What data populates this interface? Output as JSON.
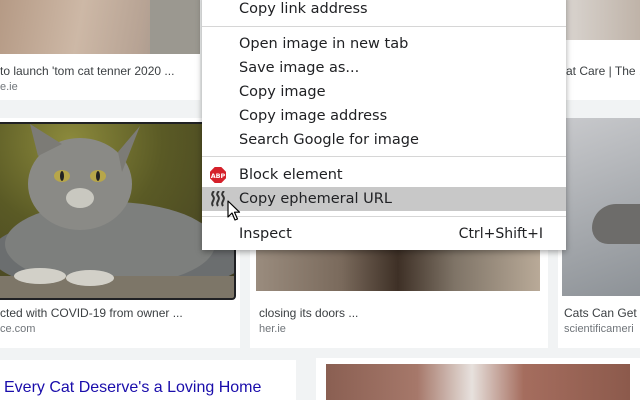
{
  "results": [
    {
      "caption": "to launch 'tom cat tenner 2020 ...",
      "source": "e.ie"
    },
    {
      "caption": "at Care | The ...",
      "source": ""
    },
    {
      "caption": "cted with COVID-19 from owner ...",
      "source": "ce.com"
    },
    {
      "caption": "closing its doors ...",
      "source": "her.ie"
    },
    {
      "caption": "Cats Can Get ...",
      "source": "scientificameri"
    }
  ],
  "bottom_title": "Every Cat Deserve's a Loving Home",
  "context_menu": {
    "items": [
      {
        "label": "Copy link address"
      },
      {
        "label": "Open image in new tab"
      },
      {
        "label": "Save image as..."
      },
      {
        "label": "Copy image"
      },
      {
        "label": "Copy image address"
      },
      {
        "label": "Search Google for image"
      },
      {
        "label": "Block element",
        "icon": "adblock-plus-icon",
        "icon_text": "ABP"
      },
      {
        "label": "Copy ephemeral URL",
        "icon": "ephemeral-url-icon"
      },
      {
        "label": "Inspect",
        "shortcut": "Ctrl+Shift+I"
      }
    ],
    "hovered": "Copy ephemeral URL"
  },
  "colors": {
    "menu_bg": "#ffffff",
    "hover_bg": "#c8c8c8",
    "abp_red": "#d5202a",
    "link_blue": "#1a0dab"
  }
}
